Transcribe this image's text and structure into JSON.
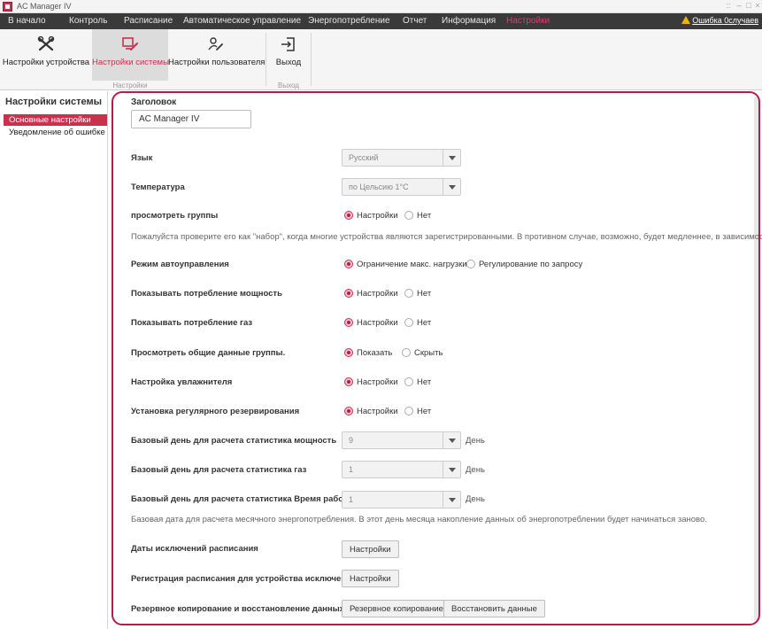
{
  "window": {
    "title": "AC Manager IV",
    "controls": [
      "::",
      "–",
      "□",
      "×"
    ]
  },
  "menu": {
    "items": [
      "В начало",
      "Контроль",
      "Расписание",
      "Автоматическое управление",
      "Энергопотребление",
      "Отчет",
      "Информация",
      "Настройки"
    ],
    "alert": "Ошибка 0случаев"
  },
  "ribbon": {
    "buttons": [
      {
        "label": "Настройки устройства",
        "icon": "tools-icon"
      },
      {
        "label": "Настройки системы",
        "icon": "system-settings-icon"
      },
      {
        "label": "Настройки пользователя",
        "icon": "user-settings-icon"
      },
      {
        "label": "Выход",
        "icon": "exit-icon"
      }
    ],
    "groups": [
      "Настройки",
      "Выход"
    ]
  },
  "sidebar": {
    "title": "Настройки системы",
    "items": [
      "Основные настройки",
      "Уведомление об ошибке"
    ]
  },
  "form": {
    "header_label": "Заголовок",
    "header_value": "AC Manager IV",
    "language": {
      "label": "Язык",
      "value": "Русский"
    },
    "temperature": {
      "label": "Температура",
      "value": "по Цельсию 1°C"
    },
    "view_groups": {
      "label": "просмотреть группы",
      "on": "Настройки",
      "off": "Нет",
      "note": "Пожалуйста проверите его как \"набор\", когда многие устройства являются зарегистрированными. В противном случае, возможно, будет медленнее, в зависимост"
    },
    "auto_mode": {
      "label": "Режим автоуправления",
      "on": "Ограничение макс. нагрузки",
      "off": "Регулирование по запросу"
    },
    "show_power": {
      "label": "Показывать потребление мощность",
      "on": "Настройки",
      "off": "Нет"
    },
    "show_gas": {
      "label": "Показывать потребление газ",
      "on": "Настройки",
      "off": "Нет"
    },
    "group_data": {
      "label": "Просмотреть общие данные группы.",
      "on": "Показать",
      "off": "Скрыть"
    },
    "humidifier": {
      "label": "Настройка увлажнителя",
      "on": "Настройки",
      "off": "Нет"
    },
    "reservation": {
      "label": "Установка регулярного резервирования",
      "on": "Настройки",
      "off": "Нет"
    },
    "base_power": {
      "label": "Базовый день для расчета статистика мощность",
      "value": "9",
      "unit": "День"
    },
    "base_gas": {
      "label": "Базовый день для расчета статистика газ",
      "value": "1",
      "unit": "День"
    },
    "base_runtime": {
      "label": "Базовый день для расчета статистика Время работы",
      "value": "1",
      "unit": "День",
      "note": "Базовая дата для расчета месячного энергопотребления. В этот день месяца накопление данных об энергопотреблении будет начинаться заново."
    },
    "exclusion_dates": {
      "label": "Даты исключений расписания",
      "button": "Настройки"
    },
    "exclusion_devices": {
      "label": "Регистрация расписания для устройства исключений",
      "button": "Настройки"
    },
    "backup": {
      "label": "Резервное копирование и восстановление данных",
      "backup_button": "Резервное копирование",
      "restore_button": "Восстановить данные"
    }
  },
  "colors": {
    "accent": "#c8324d",
    "frame": "#b01e4b",
    "menubar": "#3a3a3a",
    "warning": "#f0b400"
  }
}
